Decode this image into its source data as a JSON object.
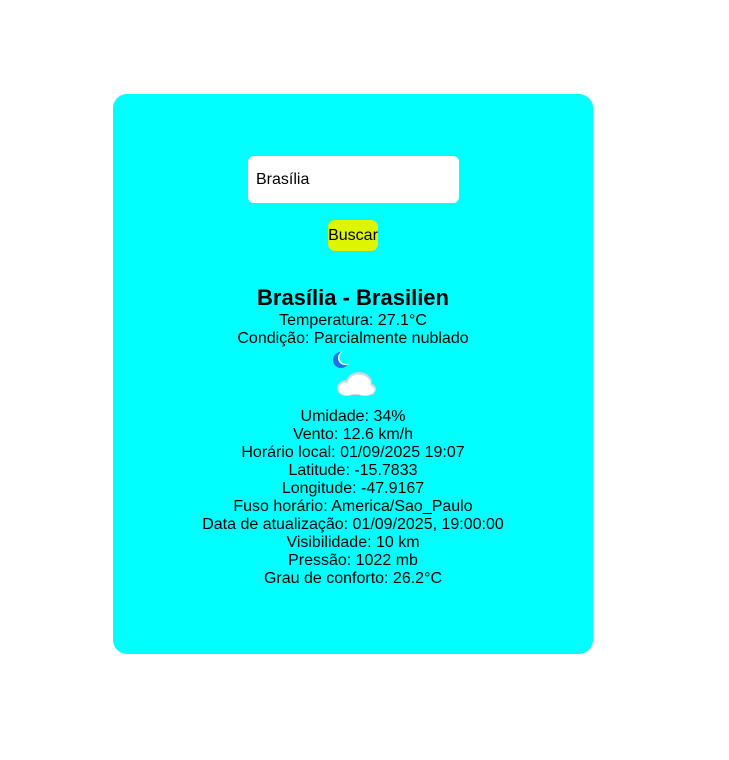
{
  "search": {
    "value": "Brasília",
    "button_label": "Buscar"
  },
  "weather": {
    "title": "Brasília - Brasilien",
    "temperature": "Temperatura: 27.1°C",
    "condition": "Condição: Parcialmente nublado",
    "icon": "partly-cloudy-night-icon",
    "humidity": "Umidade: 34%",
    "wind": "Vento: 12.6 km/h",
    "local_time": "Horário local: 01/09/2025 19:07",
    "latitude": "Latitude: -15.7833",
    "longitude": "Longitude: -47.9167",
    "timezone": "Fuso horário: America/Sao_Paulo",
    "updated": "Data de atualização: 01/09/2025, 19:00:00",
    "visibility": "Visibilidade: 10 km",
    "pressure": "Pressão: 1022 mb",
    "feels_like": "Grau de conforto: 26.2°C"
  },
  "colors": {
    "card_background": "#00ffff",
    "button_background": "#ddf500",
    "page_background": "#ffffff"
  }
}
